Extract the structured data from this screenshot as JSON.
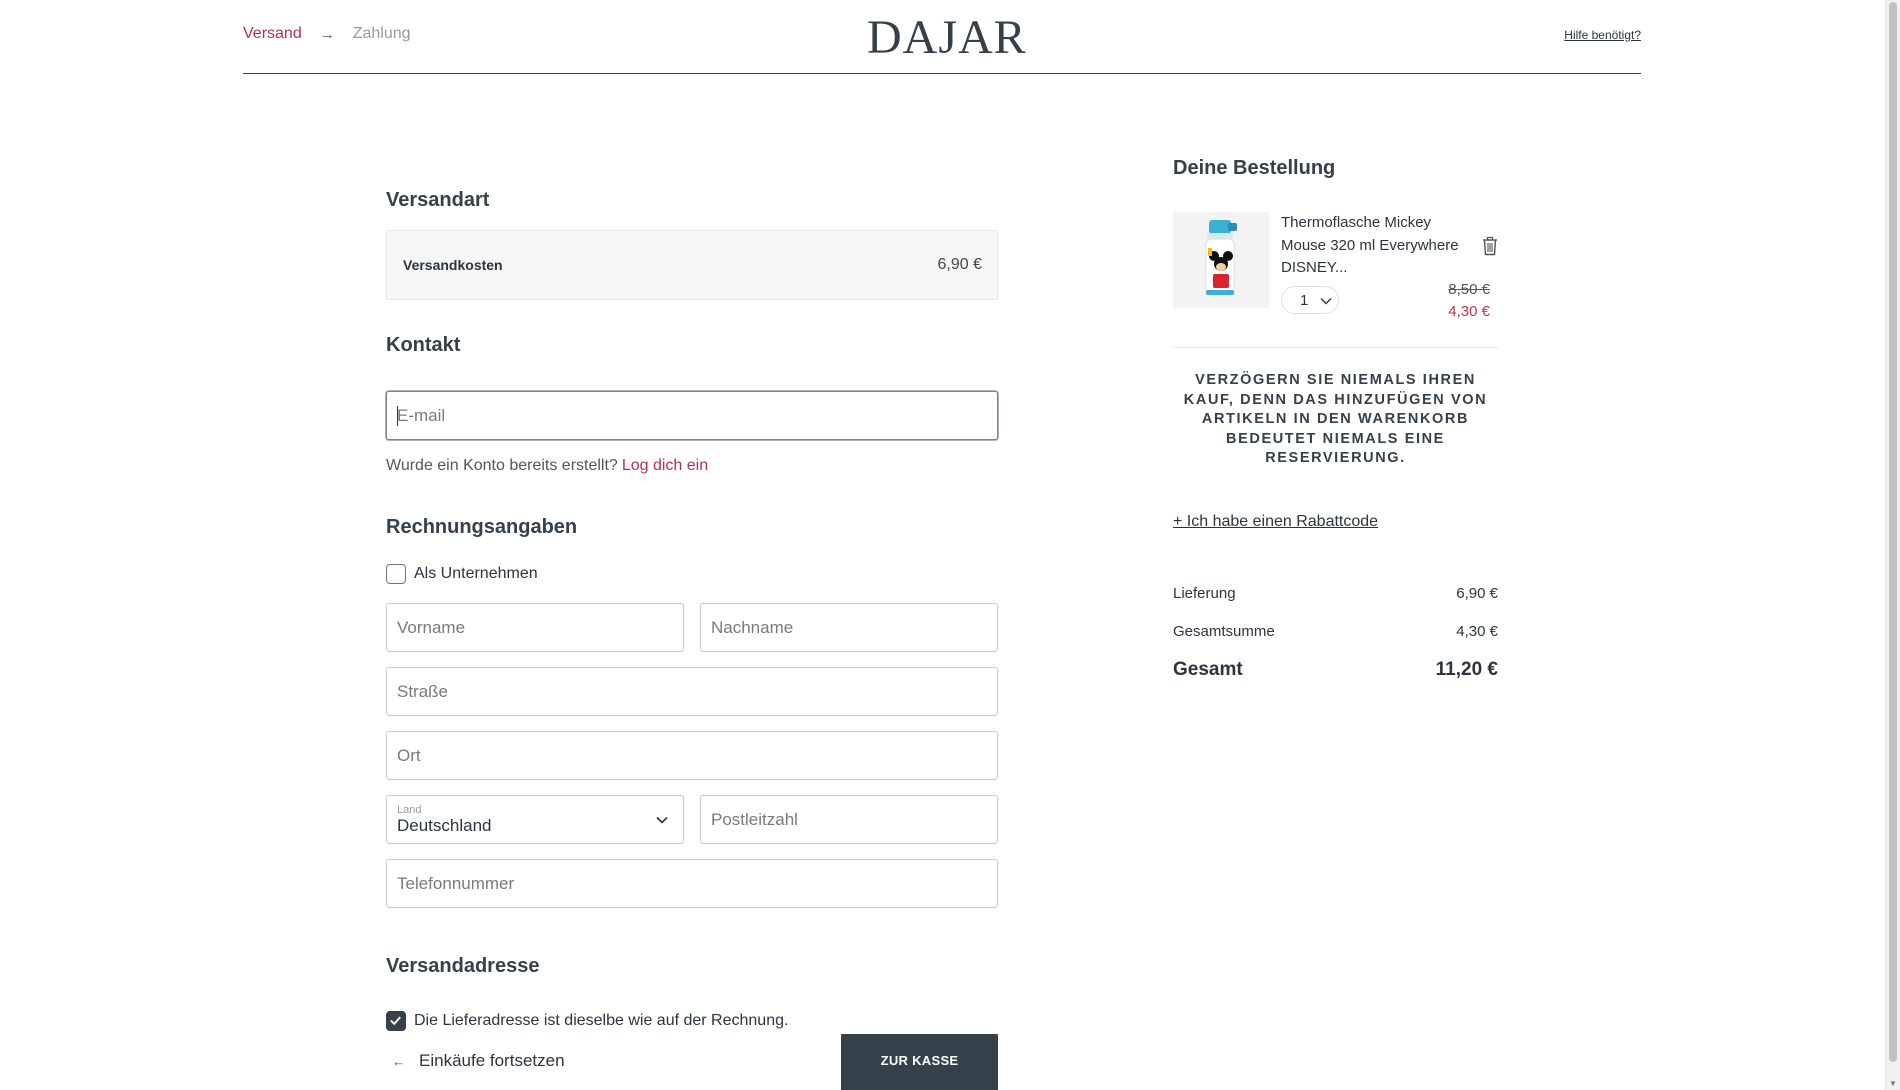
{
  "header": {
    "steps": {
      "current": "Versand",
      "next": "Zahlung"
    },
    "logo": "DAJAR",
    "help_link": "Hilfe benötigt?"
  },
  "shipping_method": {
    "title": "Versandart",
    "label": "Versandkosten",
    "price": "6,90 €"
  },
  "contact": {
    "title": "Kontakt",
    "email_placeholder": "E-mail",
    "login_prompt": "Wurde ein Konto bereits erstellt?",
    "login_link": "Log dich ein"
  },
  "billing": {
    "title": "Rechnungsangaben",
    "company_checkbox_label": "Als Unternehmen",
    "company_checked": false,
    "first_name_placeholder": "Vorname",
    "last_name_placeholder": "Nachname",
    "street_placeholder": "Straße",
    "city_placeholder": "Ort",
    "country_label": "Land",
    "country_value": "Deutschland",
    "zip_placeholder": "Postleitzahl",
    "phone_placeholder": "Telefonnummer"
  },
  "shipping_address": {
    "title": "Versandadresse",
    "same_address_label": "Die Lieferadresse ist dieselbe wie auf der Rechnung.",
    "same_address_checked": true
  },
  "actions": {
    "continue_shopping": "Einkäufe fortsetzen",
    "checkout": "ZUR KASSE"
  },
  "order": {
    "title": "Deine Bestellung",
    "item": {
      "name": "Thermoflasche Mickey Mouse 320 ml Everywhere DISNEY...",
      "quantity": "1",
      "old_price": "8,50 €",
      "new_price": "4,30 €"
    },
    "notice": "Verzögern Sie niemals Ihren Kauf, denn das Hinzufügen von Artikeln in den Warenkorb bedeutet niemals eine Reservierung.",
    "discount_link": "+ Ich habe einen Rabattcode",
    "delivery_label": "Lieferung",
    "delivery_value": "6,90 €",
    "subtotal_label": "Gesamtsumme",
    "subtotal_value": "4,30 €",
    "total_label": "Gesamt",
    "total_value": "11,20 €"
  },
  "colors": {
    "accent": "#b0334f",
    "primary_dark": "#36404b",
    "sale_red": "#c2354a"
  }
}
